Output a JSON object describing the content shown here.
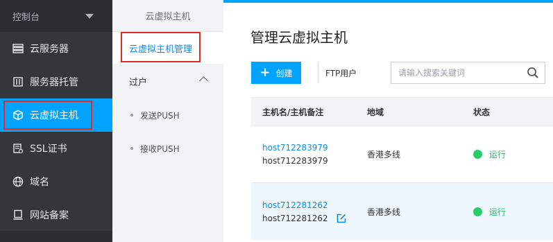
{
  "sidebar": {
    "header": "控制台",
    "items": [
      {
        "label": "云服务器",
        "icon": "server-list-icon"
      },
      {
        "label": "服务器托管",
        "icon": "server-hosting-icon"
      },
      {
        "label": "云虚拟主机",
        "icon": "cube-icon",
        "active": true
      },
      {
        "label": "SSL证书",
        "icon": "certificate-icon"
      },
      {
        "label": "域名",
        "icon": "globe-icon"
      },
      {
        "label": "网站备案",
        "icon": "record-icon"
      }
    ]
  },
  "subnav": {
    "title": "云虚拟主机",
    "active": "云虚拟主机管理",
    "group": "过户",
    "group_items": [
      "发送PUSH",
      "接收PUSH"
    ]
  },
  "main": {
    "title": "管理云虚拟主机",
    "create_label": "创建",
    "ftp_label": "FTP用户",
    "search_placeholder": "请输入搜索关键词",
    "columns": [
      "主机名/主机备注",
      "地域",
      "状态"
    ],
    "rows": [
      {
        "host_link": "host712283979",
        "host_name": "host712283979",
        "region": "香港多线",
        "status": "运行",
        "editable": false
      },
      {
        "host_link": "host712281262",
        "host_name": "host712281262",
        "region": "香港多线",
        "status": "运行",
        "editable": true
      }
    ]
  },
  "colors": {
    "accent": "#00a4ff",
    "sidebar_bg": "#33373c",
    "status_ok": "#29cc6a",
    "highlight_box": "#e02a2a"
  }
}
